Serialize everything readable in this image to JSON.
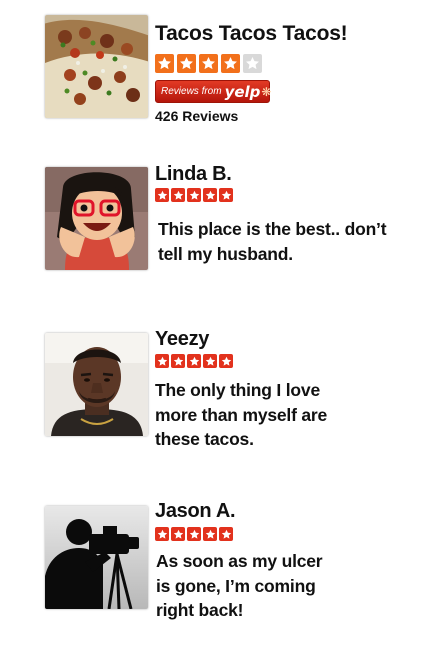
{
  "business": {
    "name": "Tacos Tacos Tacos!",
    "rating": 4,
    "max_rating": 5,
    "badge": {
      "from_text": "Reviews from",
      "brand": "yelp"
    },
    "review_count": "426 Reviews"
  },
  "reviews": [
    {
      "name": "Linda B.",
      "rating": 5,
      "text_lines": [
        "This place is the best.. don’t",
        "tell my husband."
      ]
    },
    {
      "name": "Yeezy",
      "rating": 5,
      "text_lines": [
        "The only thing I love",
        "more than myself are",
        "these tacos."
      ]
    },
    {
      "name": "Jason A.",
      "rating": 5,
      "text_lines": [
        "As soon as my ulcer",
        "is gone, I’m coming",
        "right back!"
      ]
    }
  ],
  "colors": {
    "star_red": "#e2321d",
    "star_orange": "#f2701b",
    "star_empty": "#d9d9d9",
    "yelp_red": "#c41200"
  },
  "icons": {
    "star": "star-icon",
    "yelp_burst": "yelp-burst-icon"
  }
}
